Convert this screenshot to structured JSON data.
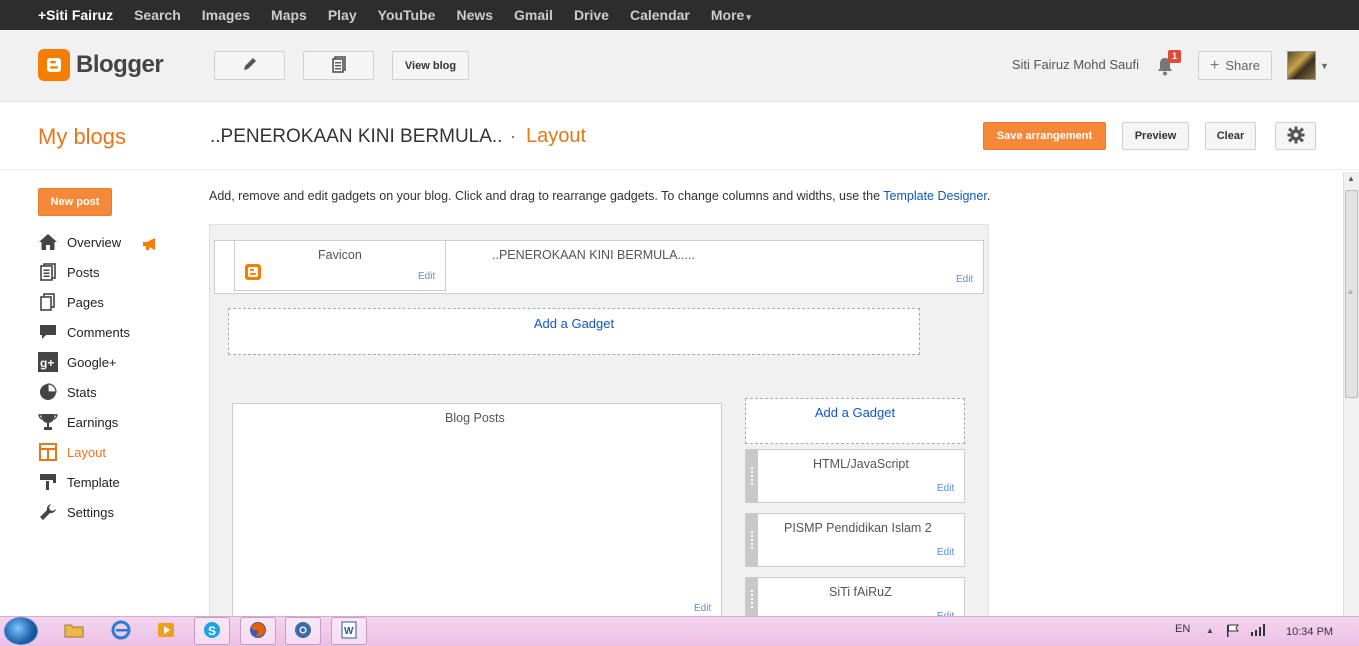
{
  "google_bar": {
    "items": [
      "+Siti Fairuz",
      "Search",
      "Images",
      "Maps",
      "Play",
      "YouTube",
      "News",
      "Gmail",
      "Drive",
      "Calendar",
      "More"
    ],
    "more_caret": "▾"
  },
  "header": {
    "logo_text": "Blogger",
    "view_blog": "View blog",
    "user_name": "Siti Fairuz Mohd Saufi",
    "notification_count": "1",
    "share_label": "Share"
  },
  "title_bar": {
    "my_blogs": "My blogs",
    "blog_name": "..PENEROKAAN KINI BERMULA..",
    "separator": "·",
    "page_name": "Layout",
    "save_arrangement": "Save arrangement",
    "preview": "Preview",
    "clear": "Clear"
  },
  "sidebar": {
    "new_post": "New post",
    "items": [
      {
        "label": "Overview",
        "icon": "home-icon"
      },
      {
        "label": "Posts",
        "icon": "posts-icon"
      },
      {
        "label": "Pages",
        "icon": "pages-icon"
      },
      {
        "label": "Comments",
        "icon": "comments-icon"
      },
      {
        "label": "Google+",
        "icon": "google-plus-icon"
      },
      {
        "label": "Stats",
        "icon": "stats-icon"
      },
      {
        "label": "Earnings",
        "icon": "earnings-icon"
      },
      {
        "label": "Layout",
        "icon": "layout-icon",
        "active": true
      },
      {
        "label": "Template",
        "icon": "template-icon"
      },
      {
        "label": "Settings",
        "icon": "settings-icon"
      }
    ]
  },
  "main": {
    "instructions_text": "Add, remove and edit gadgets on your blog. Click and drag to rearrange gadgets. To change columns and widths, use the ",
    "instructions_link": "Template Designer",
    "instructions_end": ".",
    "favicon_title": "Favicon",
    "header_title": "..PENEROKAAN KINI BERMULA.....",
    "add_gadget": "Add a Gadget",
    "blog_posts_title": "Blog Posts",
    "edit": "Edit",
    "sidebar_gadgets": [
      "HTML/JavaScript",
      "PISMP Pendidikan Islam 2",
      "SiTi fAiRuZ"
    ]
  },
  "taskbar": {
    "language": "EN",
    "time": "10:34 PM"
  },
  "colors": {
    "accent_orange": "#f6883a",
    "link_blue": "#1155cc",
    "google_bar_bg": "#2d2d2d",
    "taskbar_pink": "#f3d4ee"
  }
}
